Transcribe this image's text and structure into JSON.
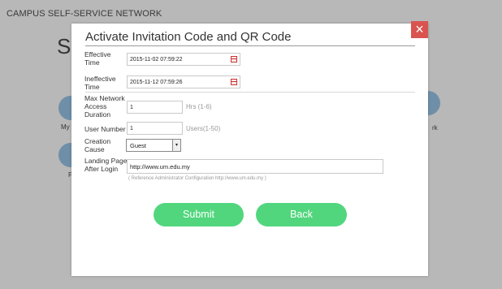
{
  "background": {
    "header_title": "CAMPUS SELF-SERVICE NETWORK",
    "big_letter": "S",
    "side_labels": {
      "left_my": "My",
      "left_p": "P",
      "right_rk": "rk"
    }
  },
  "modal": {
    "title": "Activate Invitation Code and QR Code",
    "close_glyph": "×",
    "fields": {
      "effective_time": {
        "label_line1": "Effective",
        "label_line2": "Time",
        "value": "2015-11-02 07:59:22"
      },
      "ineffective_time": {
        "label_line1": "Ineffective",
        "label_line2": "Time",
        "value": "2015-11-12 07:59:26"
      },
      "max_duration": {
        "label_line1": "Max Network",
        "label_line2": "Access",
        "label_line3": "Duration",
        "value": "1",
        "hint": "Hrs (1-6)"
      },
      "user_number": {
        "label": "User Number",
        "value": "1",
        "hint": "Users(1-50)"
      },
      "creation_cause": {
        "label_line1": "Creation",
        "label_line2": "Cause",
        "selected": "Guest",
        "arrow": "▾"
      },
      "landing_page": {
        "label_line1": "Landing Page",
        "label_line2": "After Login",
        "value": "http://www.um.edu.my",
        "note": "( Reference Administrator Configuration http://www.um.edu.my )"
      }
    },
    "buttons": {
      "submit": "Submit",
      "back": "Back"
    }
  },
  "colors": {
    "overlay": "#b8b8b8",
    "close": "#d9534f",
    "button": "#51d67d"
  }
}
